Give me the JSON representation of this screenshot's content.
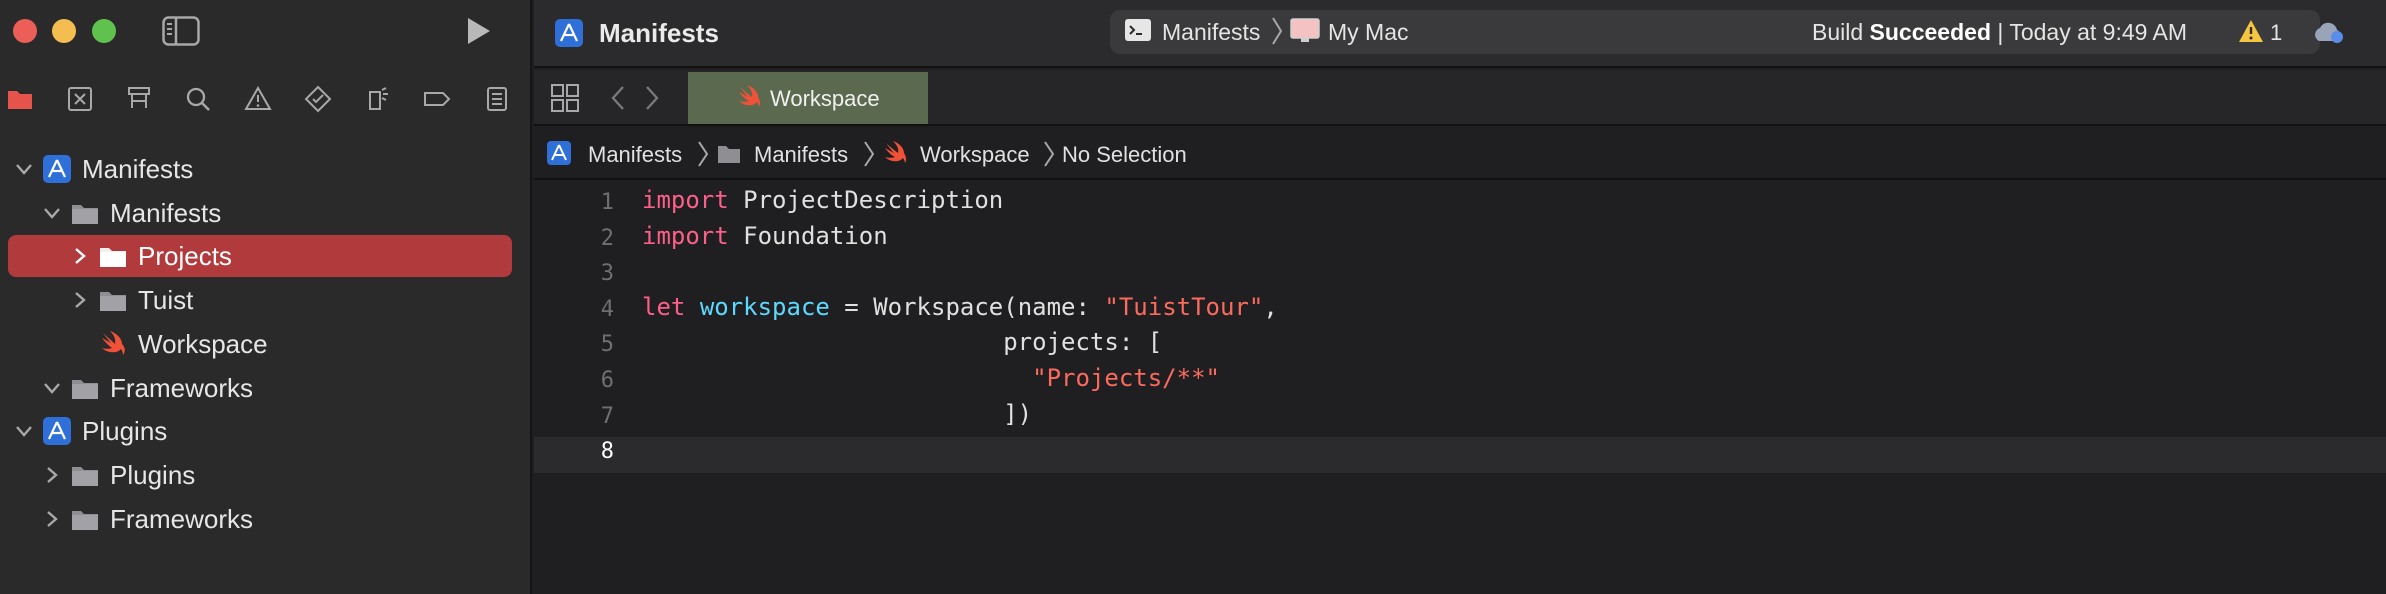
{
  "window": {
    "controls": [
      "close",
      "minimize",
      "maximize"
    ]
  },
  "navigator": {
    "tabs": [
      {
        "name": "project-navigator-icon",
        "color": "#e5534b"
      },
      {
        "name": "source-control-icon"
      },
      {
        "name": "symbol-navigator-icon"
      },
      {
        "name": "find-navigator-icon"
      },
      {
        "name": "issue-navigator-icon"
      },
      {
        "name": "test-navigator-icon"
      },
      {
        "name": "debug-navigator-icon"
      },
      {
        "name": "breakpoint-navigator-icon"
      },
      {
        "name": "report-navigator-icon"
      }
    ],
    "tree": [
      {
        "label": "Manifests",
        "icon": "xcode-project-icon",
        "expanded": true,
        "level": 0
      },
      {
        "label": "Manifests",
        "icon": "folder-icon",
        "expanded": true,
        "level": 1
      },
      {
        "label": "Projects",
        "icon": "folder-icon",
        "expanded": false,
        "level": 2,
        "selected": true
      },
      {
        "label": "Tuist",
        "icon": "folder-icon",
        "expanded": false,
        "level": 2
      },
      {
        "label": "Workspace",
        "icon": "swift-file-icon",
        "level": 2
      },
      {
        "label": "Frameworks",
        "icon": "folder-icon",
        "expanded": true,
        "level": 1
      },
      {
        "label": "Plugins",
        "icon": "xcode-project-icon",
        "expanded": true,
        "level": 0
      },
      {
        "label": "Plugins",
        "icon": "folder-icon",
        "expanded": false,
        "level": 1
      },
      {
        "label": "Frameworks",
        "icon": "folder-icon",
        "expanded": false,
        "level": 1
      }
    ]
  },
  "toolbar": {
    "project_title": "Manifests",
    "scheme": "Manifests",
    "destination": "My Mac",
    "status_prefix": "Build ",
    "status_bold": "Succeeded",
    "status_suffix": " | Today at 9:49 AM",
    "warning_count": "1"
  },
  "tab": {
    "label": "Workspace"
  },
  "jumpbar": {
    "items": [
      "Manifests",
      "Manifests",
      "Workspace",
      "No Selection"
    ]
  },
  "editor": {
    "current_line": 8,
    "line_numbers": [
      "1",
      "2",
      "3",
      "4",
      "5",
      "6",
      "7",
      "8"
    ],
    "lines": [
      [
        {
          "t": "import",
          "c": "kw"
        },
        {
          "t": " ProjectDescription",
          "c": ""
        }
      ],
      [
        {
          "t": "import",
          "c": "kw"
        },
        {
          "t": " Foundation",
          "c": ""
        }
      ],
      [],
      [
        {
          "t": "let",
          "c": "kw"
        },
        {
          "t": " ",
          "c": ""
        },
        {
          "t": "workspace",
          "c": "ident"
        },
        {
          "t": " = Workspace(name: ",
          "c": ""
        },
        {
          "t": "\"TuistTour\"",
          "c": "str"
        },
        {
          "t": ",",
          "c": ""
        }
      ],
      [
        {
          "t": "                         projects: [",
          "c": ""
        }
      ],
      [
        {
          "t": "                           ",
          "c": ""
        },
        {
          "t": "\"Projects/**\"",
          "c": "str"
        }
      ],
      [
        {
          "t": "                         ])",
          "c": ""
        }
      ],
      []
    ]
  },
  "colors": {
    "selection": "#b13b3c",
    "keyword": "#fc5f89",
    "identifier": "#5dd8ff",
    "string": "#fc6a5d",
    "tab_active": "#5b6a4e"
  }
}
